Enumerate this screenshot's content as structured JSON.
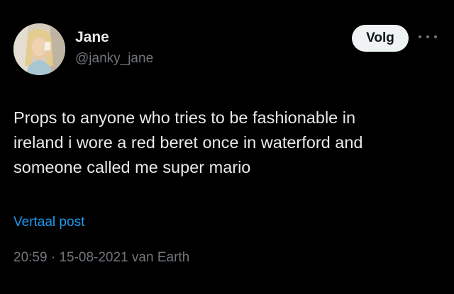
{
  "author": {
    "display_name": "Jane",
    "handle": "@janky_jane"
  },
  "follow_button": "Volg",
  "more_icon": "ellipsis-icon",
  "tweet": {
    "lines": [
      "Props to anyone who tries to be fashionable in",
      "ireland i wore a red beret once in waterford and",
      "someone called me super mario"
    ]
  },
  "translate_link": "Vertaal post",
  "meta": {
    "time": "20:59",
    "separator": " · ",
    "date": "15-08-2021",
    "source": " van Earth"
  },
  "colors": {
    "background": "#000000",
    "primary_text": "#e7e9ea",
    "secondary_text": "#71767b",
    "link": "#1d9bf0",
    "button_bg": "#eff3f4"
  }
}
